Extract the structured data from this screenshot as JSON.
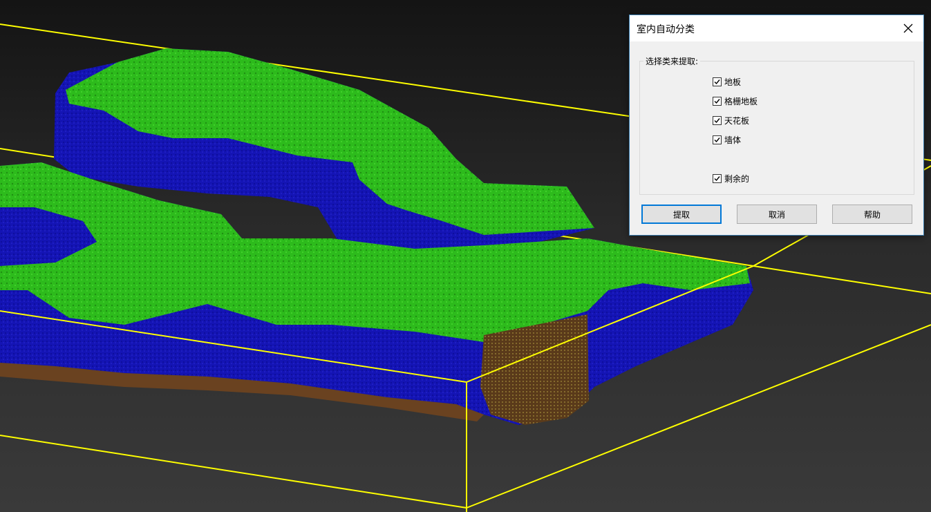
{
  "dialog": {
    "title": "室内自动分类",
    "group_label": "选择类来提取:",
    "classes": [
      {
        "label": "地板",
        "checked": true
      },
      {
        "label": "格栅地板",
        "checked": true
      },
      {
        "label": "天花板",
        "checked": true
      },
      {
        "label": "墙体",
        "checked": true
      },
      {
        "label": "剩余的",
        "checked": true
      }
    ],
    "buttons": {
      "extract": "提取",
      "cancel": "取消",
      "help": "帮助"
    }
  },
  "icons": {
    "close": "close-icon",
    "checkbox": "checkmark-icon"
  },
  "colors": {
    "background_top": "#141414",
    "background_bottom": "#3a3a3a",
    "bounding_box": "#ffff00",
    "class_floor": "#2dbb1c",
    "class_wall": "#1414b4",
    "class_remaining": "#5a3a1a",
    "dialog_bg": "#f0f0f0",
    "dialog_border": "#3c7fb1",
    "accent": "#0078d7"
  }
}
